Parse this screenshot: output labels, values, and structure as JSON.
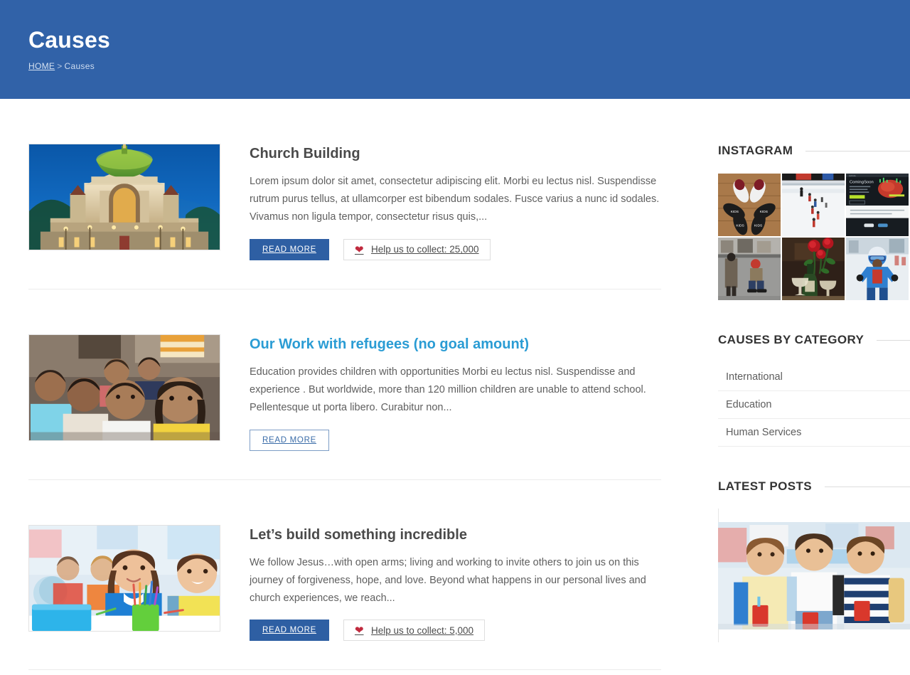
{
  "header": {
    "title": "Causes",
    "breadcrumb": {
      "home": "HOME",
      "separator": ">",
      "current": "Causes"
    },
    "background_color": "#3162a8"
  },
  "colors": {
    "primary_blue": "#2e5fa3",
    "header_blue": "#3162a8",
    "link_cyan": "#2a9cd4",
    "heart_red": "#c02a3e",
    "text_gray": "#5f5f5f",
    "title_gray": "#4a4a4a",
    "divider": "#ececec"
  },
  "causes": [
    {
      "title": "Church Building",
      "title_is_link": false,
      "excerpt": "Lorem ipsum dolor sit amet, consectetur adipiscing elit. Morbi eu lectus nisl. Suspendisse rutrum purus tellus, at ullamcorper est bibendum sodales. Fusce varius a nunc id sodales. Vivamus non ligula tempor, consectetur risus quis,...",
      "read_more_label": "READ MORE",
      "read_more_style": "solid",
      "has_donate": true,
      "donate_label": "Help us to collect: 25,000",
      "donate_icon": "heart-icon",
      "image_alt": "church-building-basilica-at-dusk"
    },
    {
      "title": "Our Work with refugees (no goal amount)",
      "title_is_link": true,
      "excerpt": "Education provides children with opportunities  Morbi eu lectus nisl. Suspendisse and experience . But worldwide, more than 120 million children are unable to attend school. Pellentesque ut porta libero. Curabitur non...",
      "read_more_label": "READ MORE",
      "read_more_style": "outline",
      "has_donate": false,
      "donate_label": "",
      "donate_icon": "",
      "image_alt": "group-of-children-smiling"
    },
    {
      "title": "Let’s build something incredible",
      "title_is_link": false,
      "excerpt": "We follow Jesus…with open arms; living and working to invite others to join us on this journey of forgiveness, hope, and love. Beyond what happens in our personal lives and church experiences, we reach...",
      "read_more_label": "READ MORE",
      "read_more_style": "solid",
      "has_donate": true,
      "donate_label": "Help us to collect: 5,000",
      "donate_icon": "heart-icon",
      "image_alt": "children-in-classroom-with-pencils"
    }
  ],
  "sidebar": {
    "instagram": {
      "title": "INSTAGRAM",
      "tiles": [
        {
          "alt": "sneakers-on-wooden-floor"
        },
        {
          "alt": "skaters-on-ice-rink"
        },
        {
          "alt": "dark-website-coming-soon-screen"
        },
        {
          "alt": "child-skating-on-street"
        },
        {
          "alt": "wine-bottle-and-red-roses"
        },
        {
          "alt": "child-in-blue-snowsuit-with-goggles"
        }
      ]
    },
    "categories": {
      "title": "CAUSES BY CATEGORY",
      "items": [
        {
          "label": "International"
        },
        {
          "label": "Education"
        },
        {
          "label": "Human Services"
        }
      ]
    },
    "latest_posts": {
      "title": "LATEST POSTS",
      "thumb_alt": "three-school-children-with-drinks"
    }
  }
}
